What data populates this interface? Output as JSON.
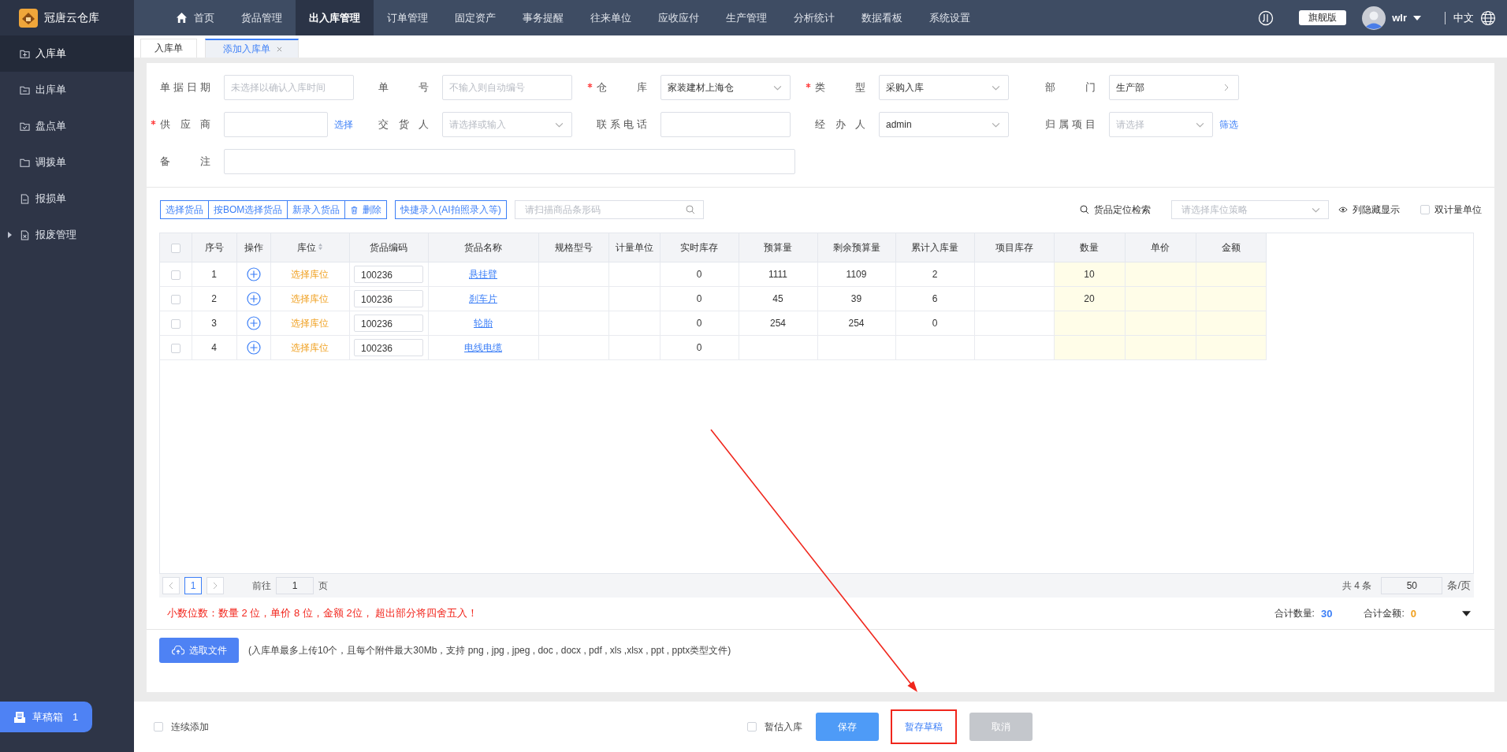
{
  "app": {
    "title": "冠唐云仓库"
  },
  "nav": [
    {
      "label": "首页",
      "selected": false,
      "home": true
    },
    {
      "label": "货品管理",
      "selected": false
    },
    {
      "label": "出入库管理",
      "selected": true
    },
    {
      "label": "订单管理",
      "selected": false
    },
    {
      "label": "固定资产",
      "selected": false
    },
    {
      "label": "事务提醒",
      "selected": false
    },
    {
      "label": "往来单位",
      "selected": false
    },
    {
      "label": "应收应付",
      "selected": false
    },
    {
      "label": "生产管理",
      "selected": false
    },
    {
      "label": "分析统计",
      "selected": false
    },
    {
      "label": "数据看板",
      "selected": false
    },
    {
      "label": "系统设置",
      "selected": false
    }
  ],
  "header_right": {
    "edition": "旗舰版",
    "user": "wlr",
    "language": "中文"
  },
  "sidebar": {
    "items": [
      {
        "label": "入库单",
        "selected": true,
        "kind": "in"
      },
      {
        "label": "出库单",
        "selected": false,
        "kind": "out"
      },
      {
        "label": "盘点单",
        "selected": false,
        "kind": "check"
      },
      {
        "label": "调拨单",
        "selected": false,
        "kind": "folder"
      },
      {
        "label": "报损单",
        "selected": false,
        "kind": "doc"
      },
      {
        "label": "报废管理",
        "selected": false,
        "kind": "scrap",
        "expandable": true
      }
    ],
    "drafts": {
      "label": "草稿箱",
      "count": "1"
    }
  },
  "tabs": [
    {
      "label": "入库单",
      "selected": false,
      "closable": false
    },
    {
      "label": "添加入库单",
      "selected": true,
      "closable": true
    }
  ],
  "form": {
    "rows": [
      [
        {
          "label": "单据日期",
          "required": false,
          "kind": "input",
          "placeholder": "未选择以确认入库时间"
        },
        {
          "label": "单号",
          "required": false,
          "kind": "input",
          "placeholder": "不输入则自动编号"
        },
        {
          "label": "仓库",
          "required": true,
          "kind": "select",
          "value": "家装建材上海仓"
        },
        {
          "label": "类型",
          "required": true,
          "kind": "select",
          "value": "采购入库"
        },
        {
          "label": "部门",
          "required": false,
          "kind": "picker",
          "value": "生产部"
        }
      ],
      [
        {
          "label": "供应商",
          "required": true,
          "kind": "input",
          "link": "选择"
        },
        {
          "label": "交货人",
          "required": false,
          "kind": "select",
          "placeholder": "请选择或输入"
        },
        {
          "label": "联系电话",
          "required": false,
          "kind": "input"
        },
        {
          "label": "经办人",
          "required": false,
          "kind": "select",
          "value": "admin"
        },
        {
          "label": "归属项目",
          "required": false,
          "kind": "select",
          "placeholder": "请选择",
          "link": "筛选"
        }
      ],
      [
        {
          "label": "备注",
          "required": false,
          "kind": "input",
          "wide": true
        }
      ]
    ]
  },
  "toolbar": {
    "group": [
      {
        "label": "选择货品",
        "kind": "text"
      },
      {
        "label": "按BOM选择货品",
        "kind": "text"
      },
      {
        "label": "新录入货品",
        "kind": "text"
      },
      {
        "label": "删除",
        "kind": "delete"
      }
    ],
    "quick_entry": "快捷录入(AI拍照录入等)",
    "scan_placeholder": "请扫描商品条形码",
    "locate": "货品定位检索",
    "strategy_placeholder": "请选择库位策略",
    "column_toggle": "列隐藏显示",
    "dual_unit": {
      "label": "双计量单位",
      "checked": false
    }
  },
  "table": {
    "header_checked": false,
    "columns": [
      {
        "kind": "check"
      },
      {
        "label": "序号",
        "kind": "text"
      },
      {
        "label": "操作",
        "kind": "text"
      },
      {
        "label": "库位",
        "kind": "text",
        "sortable": true
      },
      {
        "label": "货品编码",
        "kind": "text"
      },
      {
        "label": "货品名称",
        "kind": "text"
      },
      {
        "label": "规格型号",
        "kind": "text"
      },
      {
        "label": "计量单位",
        "kind": "text"
      },
      {
        "label": "实时库存",
        "kind": "text"
      },
      {
        "label": "预算量",
        "kind": "text"
      },
      {
        "label": "剩余预算量",
        "kind": "text"
      },
      {
        "label": "累计入库量",
        "kind": "text"
      },
      {
        "label": "项目库存",
        "kind": "text"
      },
      {
        "label": "数量",
        "kind": "edit"
      },
      {
        "label": "单价",
        "kind": "edit"
      },
      {
        "label": "金额",
        "kind": "edit"
      }
    ],
    "rows": [
      {
        "checked": false,
        "seq": "1",
        "location": "选择库位",
        "code": "100236",
        "name": "悬挂臂",
        "stock": "0",
        "budget": "1111",
        "remaining": "1109",
        "cumulative": "2",
        "quantity": "10"
      },
      {
        "checked": false,
        "seq": "2",
        "location": "选择库位",
        "code": "100236",
        "name": "刹车片",
        "stock": "0",
        "budget": "45",
        "remaining": "39",
        "cumulative": "6",
        "quantity": "20"
      },
      {
        "checked": false,
        "seq": "3",
        "location": "选择库位",
        "code": "100236",
        "name": "轮胎",
        "stock": "0",
        "budget": "254",
        "remaining": "254",
        "cumulative": "0"
      },
      {
        "checked": false,
        "seq": "4",
        "location": "选择库位",
        "code": "100236",
        "name": "电线电缆",
        "stock": "0"
      }
    ]
  },
  "pagination": {
    "current": "1",
    "goto_label": "前往",
    "goto_value": "1",
    "page_unit": "页",
    "total": "共 4 条",
    "page_size": "50",
    "size_unit": "条/页"
  },
  "note": "小数位数：数量 2 位，单价 8 位，金额 2位， 超出部分将四舍五入！",
  "totals": [
    {
      "label": "合计数量:",
      "value": "30",
      "color": "#3c7ff7"
    },
    {
      "label": "合计金额:",
      "value": "0",
      "color": "#f0a020"
    }
  ],
  "upload": {
    "button": "选取文件",
    "hint": "(入库单最多上传10个，且每个附件最大30Mb，支持 png , jpg , jpeg , doc , docx , pdf , xls ,xlsx , ppt , pptx类型文件)"
  },
  "footer": {
    "continuous": {
      "label": "连续添加",
      "checked": false
    },
    "estimate": {
      "label": "暂估入库",
      "checked": false
    },
    "buttons": [
      {
        "label": "保存",
        "kind": "primary",
        "highlighted": false
      },
      {
        "label": "暂存草稿",
        "kind": "plain",
        "highlighted": true
      },
      {
        "label": "取消",
        "kind": "disabled",
        "highlighted": false
      }
    ]
  },
  "annotation_arrow": true
}
